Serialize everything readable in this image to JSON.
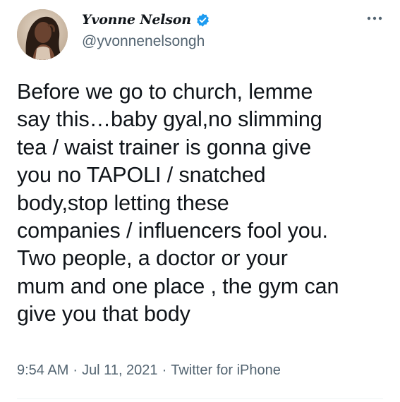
{
  "author": {
    "display_name": "Yvonne Nelson",
    "handle": "@yvonnenelsongh",
    "verified": true
  },
  "tweet": {
    "text": "Before we go to church, lemme\nsay this…baby gyal,no slimming\ntea / waist trainer is gonna give\nyou no TAPOLI / snatched\nbody,stop letting these\ncompanies / influencers fool you.\nTwo people, a doctor or your\nmum and one place , the gym can\ngive you that body",
    "time": "9:54 AM",
    "date": "Jul 11, 2021",
    "source": "Twitter for iPhone",
    "separator": "·"
  },
  "icons": {
    "more": "more-horizontal-icon",
    "verified": "verified-badge-icon"
  },
  "colors": {
    "text": "#0f1419",
    "secondary": "#536471",
    "verified": "#1d9bf0"
  }
}
